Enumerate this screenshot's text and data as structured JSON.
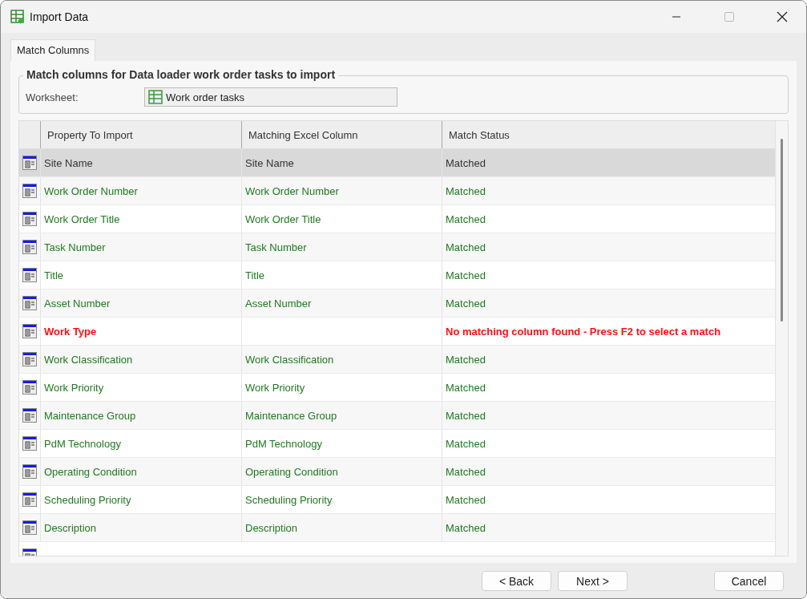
{
  "window": {
    "title": "Import Data"
  },
  "tabs": [
    {
      "label": "Match Columns",
      "selected": true
    }
  ],
  "group": {
    "title": "Match columns for Data loader work order tasks to import",
    "worksheet_label": "Worksheet:",
    "worksheet_value": "Work order tasks"
  },
  "table": {
    "columns": [
      "Property To Import",
      "Matching Excel Column",
      "Match Status"
    ],
    "rows": [
      {
        "kind": "matched",
        "selected": true,
        "property": "Site Name",
        "column": "Site Name",
        "status": "Matched"
      },
      {
        "kind": "matched",
        "selected": false,
        "property": "Work Order Number",
        "column": "Work Order Number",
        "status": "Matched"
      },
      {
        "kind": "matched",
        "selected": false,
        "property": "Work Order Title",
        "column": "Work Order Title",
        "status": "Matched"
      },
      {
        "kind": "matched",
        "selected": false,
        "property": "Task Number",
        "column": "Task Number",
        "status": "Matched"
      },
      {
        "kind": "matched",
        "selected": false,
        "property": "Title",
        "column": "Title",
        "status": "Matched"
      },
      {
        "kind": "matched",
        "selected": false,
        "property": "Asset Number",
        "column": "Asset Number",
        "status": "Matched"
      },
      {
        "kind": "unmatched",
        "selected": false,
        "property": "Work Type",
        "status": "No matching column found - Press F2 to select a match"
      },
      {
        "kind": "matched",
        "selected": false,
        "property": "Work Classification",
        "column": "Work Classification",
        "status": "Matched"
      },
      {
        "kind": "matched",
        "selected": false,
        "property": "Work Priority",
        "column": "Work Priority",
        "status": "Matched"
      },
      {
        "kind": "matched",
        "selected": false,
        "property": "Maintenance Group",
        "column": "Maintenance Group",
        "status": "Matched"
      },
      {
        "kind": "matched",
        "selected": false,
        "property": "PdM Technology",
        "column": "PdM Technology",
        "status": "Matched"
      },
      {
        "kind": "matched",
        "selected": false,
        "property": "Operating Condition",
        "column": "Operating Condition",
        "status": "Matched"
      },
      {
        "kind": "matched",
        "selected": false,
        "property": "Scheduling Priority",
        "column": "Scheduling Priority",
        "status": "Matched"
      },
      {
        "kind": "matched",
        "selected": false,
        "property": "Description",
        "column": "Description",
        "status": "Matched"
      }
    ]
  },
  "buttons": [
    {
      "label": "< Back",
      "kind": "nav"
    },
    {
      "label": "Next >",
      "kind": "nav"
    },
    {
      "label": "Cancel",
      "kind": "cancel"
    }
  ]
}
